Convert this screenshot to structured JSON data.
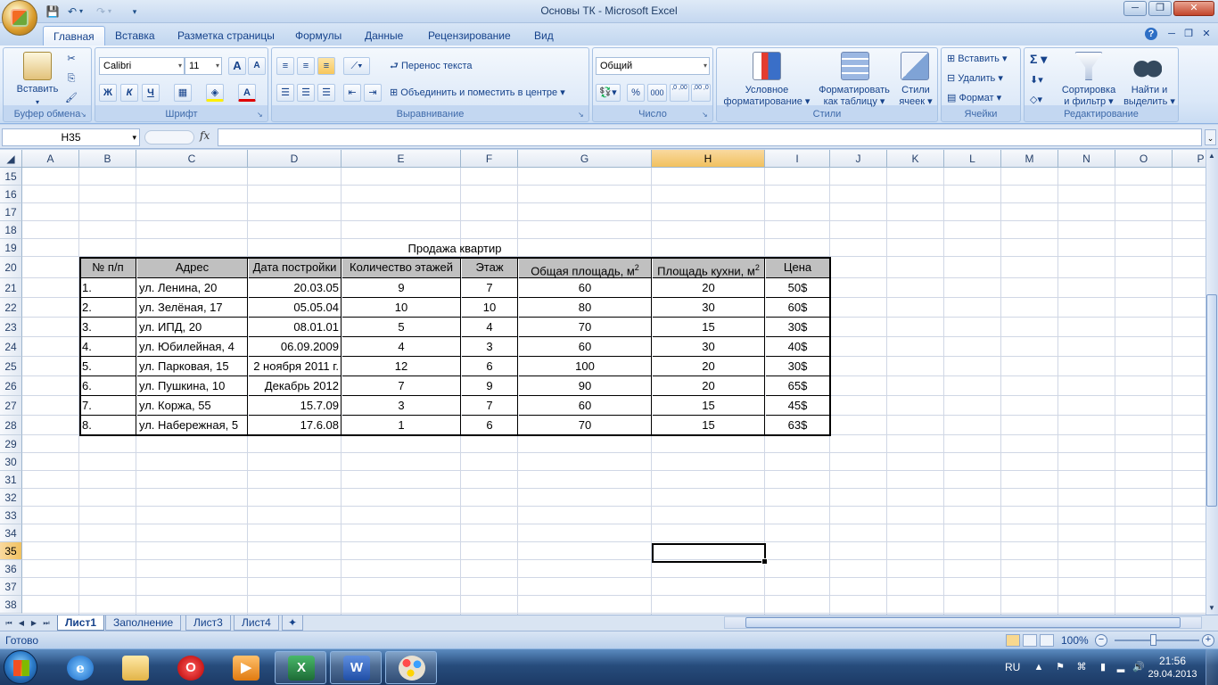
{
  "window": {
    "title": "Основы ТК - Microsoft Excel"
  },
  "qat": {
    "save_icon": "save-icon",
    "undo_icon": "undo-icon",
    "redo_icon": "redo-icon"
  },
  "tabs": [
    "Главная",
    "Вставка",
    "Разметка страницы",
    "Формулы",
    "Данные",
    "Рецензирование",
    "Вид"
  ],
  "ribbon": {
    "clipboard": {
      "label": "Буфер обмена",
      "paste": "Вставить"
    },
    "font": {
      "label": "Шрифт",
      "font_name": "Calibri",
      "font_size": "11",
      "bold": "Ж",
      "italic": "К",
      "underline": "Ч",
      "grow": "A",
      "shrink": "A"
    },
    "alignment": {
      "label": "Выравнивание",
      "wrap": "Перенос текста",
      "merge": "Объединить и поместить в центре"
    },
    "number": {
      "label": "Число",
      "format": "Общий",
      "percent": "%",
      "thousands": "000",
      "inc_dec": ",0 ,00",
      "dec_dec": ",00 ,0"
    },
    "styles": {
      "label": "Стили",
      "cond_format_1": "Условное",
      "cond_format_2": "форматирование",
      "as_table_1": "Форматировать",
      "as_table_2": "как таблицу",
      "cell_styles_1": "Стили",
      "cell_styles_2": "ячеек"
    },
    "cells": {
      "label": "Ячейки",
      "insert": "Вставить",
      "delete": "Удалить",
      "format": "Формат"
    },
    "editing": {
      "label": "Редактирование",
      "sum": "Σ",
      "sort_1": "Сортировка",
      "sort_2": "и фильтр",
      "find_1": "Найти и",
      "find_2": "выделить"
    }
  },
  "formula_bar": {
    "name_box": "H35",
    "fx": "fx",
    "value": ""
  },
  "columns": [
    "A",
    "B",
    "C",
    "D",
    "E",
    "F",
    "G",
    "H",
    "I",
    "J",
    "K",
    "L",
    "M",
    "N",
    "O",
    "P"
  ],
  "rows": [
    "15",
    "16",
    "17",
    "18",
    "19",
    "20",
    "21",
    "22",
    "23",
    "24",
    "25",
    "26",
    "27",
    "28",
    "29",
    "30",
    "31",
    "32",
    "33",
    "34",
    "35",
    "36",
    "37",
    "38"
  ],
  "selected": {
    "column": "H",
    "row": "35"
  },
  "sheet": {
    "title": "Продажа квартир",
    "headers": [
      "№ п/п",
      "Адрес",
      "Дата постройки",
      "Количество этажей",
      "Этаж",
      "Общая площадь, м",
      "Площадь кухни, м",
      "Цена"
    ],
    "superscript": "2",
    "data": [
      [
        "1.",
        "ул. Ленина, 20",
        "20.03.05",
        "9",
        "7",
        "60",
        "20",
        "50$"
      ],
      [
        "2.",
        "ул. Зелёная, 17",
        "05.05.04",
        "10",
        "10",
        "80",
        "30",
        "60$"
      ],
      [
        "3.",
        "ул. ИПД, 20",
        "08.01.01",
        "5",
        "4",
        "70",
        "15",
        "30$"
      ],
      [
        "4.",
        "ул. Юбилейная, 4",
        "06.09.2009",
        "4",
        "3",
        "60",
        "30",
        "40$"
      ],
      [
        "5.",
        "ул. Парковая, 15",
        "2 ноября 2011 г.",
        "12",
        "6",
        "100",
        "20",
        "30$"
      ],
      [
        "6.",
        "ул. Пушкина, 10",
        "Декабрь 2012",
        "7",
        "9",
        "90",
        "20",
        "65$"
      ],
      [
        "7.",
        "ул. Коржа, 55",
        "15.7.09",
        "3",
        "7",
        "60",
        "15",
        "45$"
      ],
      [
        "8.",
        "ул. Набережная, 5",
        "17.6.08",
        "1",
        "6",
        "70",
        "15",
        "63$"
      ]
    ]
  },
  "sheet_tabs": [
    "Лист1",
    "Заполнение",
    "Лист3",
    "Лист4"
  ],
  "active_sheet": "Лист1",
  "status": {
    "ready": "Готово",
    "zoom": "100%"
  },
  "taskbar": {
    "lang": "RU",
    "time": "21:56",
    "date": "29.04.2013",
    "apps": [
      "internet-explorer",
      "file-explorer",
      "opera",
      "media-player",
      "excel",
      "word",
      "paint"
    ],
    "open_apps": [
      "excel",
      "word",
      "paint"
    ]
  }
}
